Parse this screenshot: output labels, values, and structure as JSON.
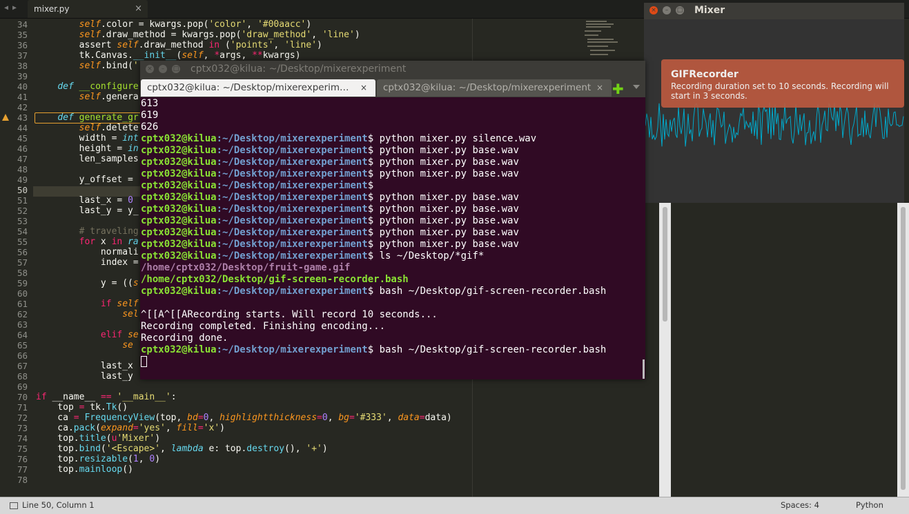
{
  "editor": {
    "tab_label": "mixer.py",
    "tab_close": "×",
    "tab_arrows": "◀ ▶",
    "line_numbers": [
      "34",
      "35",
      "36",
      "37",
      "38",
      "39",
      "40",
      "41",
      "42",
      "43",
      "44",
      "45",
      "46",
      "47",
      "48",
      "49",
      "50",
      "51",
      "52",
      "53",
      "54",
      "55",
      "56",
      "57",
      "58",
      "59",
      "60",
      "61",
      "62",
      "63",
      "64",
      "65",
      "66",
      "67",
      "68",
      "69",
      "70",
      "71",
      "72",
      "73",
      "74",
      "75",
      "76",
      "77",
      "78"
    ]
  },
  "status": {
    "position": "Line 50, Column 1",
    "spaces": "Spaces: 4",
    "language": "Python"
  },
  "terminal": {
    "window_title": "cptx032@kilua: ~/Desktop/mixerexperiment",
    "tabs": [
      {
        "label": "cptx032@kilua: ~/Desktop/mixerexperim…"
      },
      {
        "label": "cptx032@kilua: ~/Desktop/mixerexperiment"
      }
    ],
    "tab_close": "×",
    "tab_add": "✚",
    "prompt_user": "cptx032@kilua",
    "prompt_path": ":~/Desktop/mixerexperiment",
    "prompt_sign": "$",
    "lines": [
      {
        "type": "out",
        "text": "613"
      },
      {
        "type": "out",
        "text": "619"
      },
      {
        "type": "out",
        "text": "626"
      },
      {
        "type": "cmd",
        "text": " python mixer.py silence.wav"
      },
      {
        "type": "cmd",
        "text": " python mixer.py base.wav"
      },
      {
        "type": "cmd",
        "text": " python mixer.py base.wav"
      },
      {
        "type": "cmd",
        "text": " python mixer.py base.wav"
      },
      {
        "type": "cmd",
        "text": ""
      },
      {
        "type": "cmd",
        "text": " python mixer.py base.wav"
      },
      {
        "type": "cmd",
        "text": " python mixer.py base.wav"
      },
      {
        "type": "cmd",
        "text": " python mixer.py base.wav"
      },
      {
        "type": "cmd",
        "text": " python mixer.py base.wav"
      },
      {
        "type": "cmd",
        "text": " python mixer.py base.wav"
      },
      {
        "type": "cmd",
        "text": " ls ~/Desktop/*gif*"
      },
      {
        "type": "gif",
        "text": "/home/cptx032/Desktop/fruit-game.gif"
      },
      {
        "type": "bash",
        "text": "/home/cptx032/Desktop/gif-screen-recorder.bash"
      },
      {
        "type": "cmd",
        "text": " bash ~/Desktop/gif-screen-recorder.bash"
      },
      {
        "type": "out",
        "text": ""
      },
      {
        "type": "out",
        "text": "^[[A^[[ARecording starts. Will record 10 seconds..."
      },
      {
        "type": "out",
        "text": "Recording completed. Finishing encoding..."
      },
      {
        "type": "out",
        "text": "Recording done."
      },
      {
        "type": "cmd",
        "text": " bash ~/Desktop/gif-screen-recorder.bash"
      }
    ]
  },
  "mixer": {
    "window_title": "Mixer",
    "wave_color": "#00aacc",
    "background": "#333333"
  },
  "notification": {
    "title": "GIFRecorder",
    "body": "Recording duration set to 10 seconds. Recording will start in 3 seconds."
  },
  "window_buttons": {
    "close": "×",
    "minimize": "–",
    "maximize": "□"
  }
}
